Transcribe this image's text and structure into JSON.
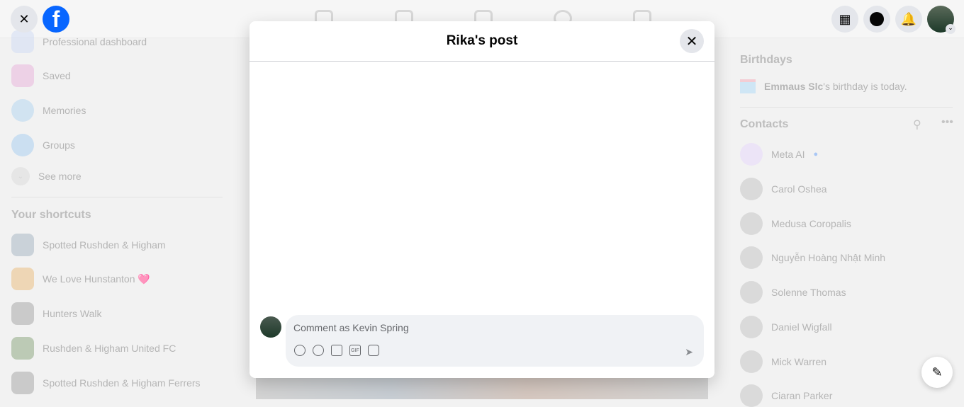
{
  "left_nav": [
    {
      "label": "Professional dashboard",
      "color": "#c9d8f5"
    },
    {
      "label": "Saved",
      "color": "#e6a8d8"
    },
    {
      "label": "Memories",
      "color": "#a8d0f0"
    },
    {
      "label": "Groups",
      "color": "#9cc8f0"
    }
  ],
  "see_more": "See more",
  "shortcuts_title": "Your shortcuts",
  "shortcuts": [
    "Spotted Rushden & Higham",
    "We Love Hunstanton 🩷",
    "Hunters Walk",
    "Rushden & Higham United FC",
    "Spotted Rushden & Higham Ferrers"
  ],
  "birthdays": {
    "title": "Birthdays",
    "name": "Emmaus Slc",
    "text": "'s birthday is today."
  },
  "contacts_title": "Contacts",
  "contacts": [
    "Meta AI",
    "Carol Oshea",
    "Medusa Coropalis",
    "Nguyễn Hoàng Nhật Minh",
    "Solenne Thomas",
    "Daniel Wigfall",
    "Mick Warren",
    "Ciaran Parker"
  ],
  "modal": {
    "title": "Rika's post",
    "comment_placeholder": "Comment as Kevin Spring",
    "tools": [
      "avatar-sticker",
      "emoji",
      "camera",
      "GIF",
      "sticker"
    ]
  },
  "colors": {
    "brand": "#0866ff"
  }
}
